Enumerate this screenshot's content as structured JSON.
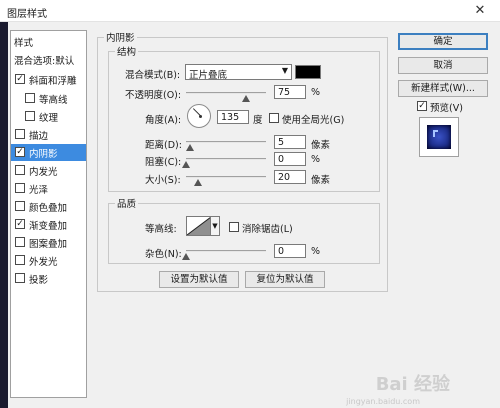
{
  "window": {
    "title": "图层样式",
    "close_glyph": "✕"
  },
  "sidebar": {
    "header": "样式",
    "blend_options": "混合选项:默认",
    "items": [
      {
        "label": "斜面和浮雕",
        "checked": true
      },
      {
        "label": "等高线",
        "checked": false
      },
      {
        "label": "纹理",
        "checked": false
      },
      {
        "label": "描边",
        "checked": false
      },
      {
        "label": "内阴影",
        "checked": true,
        "selected": true
      },
      {
        "label": "内发光",
        "checked": false
      },
      {
        "label": "光泽",
        "checked": false
      },
      {
        "label": "颜色叠加",
        "checked": false
      },
      {
        "label": "渐变叠加",
        "checked": true
      },
      {
        "label": "图案叠加",
        "checked": false
      },
      {
        "label": "外发光",
        "checked": false
      },
      {
        "label": "投影",
        "checked": false
      }
    ]
  },
  "panel": {
    "title": "内阴影",
    "structure": {
      "title": "结构",
      "blend_mode_label": "混合模式(B):",
      "blend_mode_value": "正片叠底",
      "shadow_color": "#000000",
      "opacity_label": "不透明度(O):",
      "opacity_value": "75",
      "opacity_unit": "%",
      "angle_label": "角度(A):",
      "angle_value": "135",
      "angle_unit": "度",
      "global_light_label": "使用全局光(G)",
      "global_light_checked": false,
      "distance_label": "距离(D):",
      "distance_value": "5",
      "distance_unit": "像素",
      "choke_label": "阻塞(C):",
      "choke_value": "0",
      "choke_unit": "%",
      "size_label": "大小(S):",
      "size_value": "20",
      "size_unit": "像素"
    },
    "quality": {
      "title": "品质",
      "contour_label": "等高线:",
      "antialias_label": "消除锯齿(L)",
      "antialias_checked": false,
      "noise_label": "杂色(N):",
      "noise_value": "0",
      "noise_unit": "%"
    },
    "make_default_button": "设置为默认值",
    "reset_default_button": "复位为默认值"
  },
  "actions": {
    "ok": "确定",
    "cancel": "取消",
    "new_style": "新建样式(W)...",
    "preview_label": "预览(V)",
    "preview_checked": true
  },
  "watermark": {
    "text": "Bai 经验",
    "sub": "jingyan.baidu.com"
  }
}
